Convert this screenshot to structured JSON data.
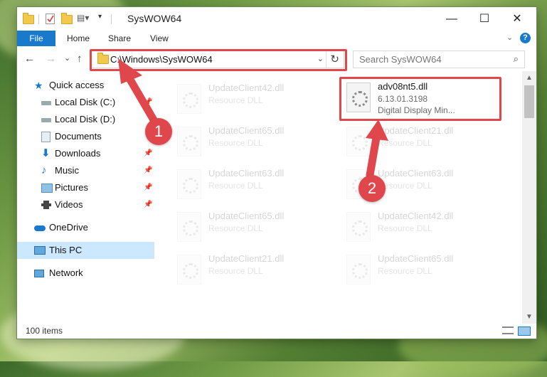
{
  "window": {
    "title": "SysWOW64",
    "minimize": "—",
    "maximize": "☐",
    "close": "✕"
  },
  "ribbon": {
    "tabs": [
      "File",
      "Home",
      "Share",
      "View"
    ],
    "collapse": "⌄",
    "help": "?"
  },
  "nav": {
    "back": "←",
    "forward": "→",
    "recent": "⌄",
    "up": "↑",
    "address": "C:\\Windows\\SysWOW64",
    "address_dropdown": "⌄",
    "refresh": "↻",
    "search_placeholder": "Search SysWOW64",
    "search_icon": "⌕"
  },
  "sidebar": {
    "items": [
      {
        "label": "Quick access",
        "icon": "star-icon"
      },
      {
        "label": "Local Disk (C:)",
        "icon": "drive-icon"
      },
      {
        "label": "Local Disk (D:)",
        "icon": "drive-icon"
      },
      {
        "label": "Documents",
        "icon": "documents-icon"
      },
      {
        "label": "Downloads",
        "icon": "downloads-icon"
      },
      {
        "label": "Music",
        "icon": "music-icon"
      },
      {
        "label": "Pictures",
        "icon": "pictures-icon"
      },
      {
        "label": "Videos",
        "icon": "videos-icon"
      },
      {
        "label": "OneDrive",
        "icon": "cloud-icon"
      },
      {
        "label": "This PC",
        "icon": "pc-icon"
      },
      {
        "label": "Network",
        "icon": "network-icon"
      }
    ],
    "pin": "📌"
  },
  "files": {
    "highlighted": {
      "name": "adv08nt5.dll",
      "version": "6.13.01.3198",
      "description": "Digital Display Min..."
    },
    "background": [
      {
        "name": "UpdateClient42.dll",
        "type": "Resource DLL"
      },
      {
        "name": "UpdateClient65.dll",
        "type": "Resource DLL"
      },
      {
        "name": "UpdateClient21.dll",
        "type": "Resource DLL"
      },
      {
        "name": "UpdateClient63.dll",
        "type": "Resource DLL"
      },
      {
        "name": "UpdateClient63.dll",
        "type": "Resource DLL"
      },
      {
        "name": "UpdateClient65.dll",
        "type": "Resource DLL"
      },
      {
        "name": "UpdateClient42.dll",
        "type": "Resource DLL"
      },
      {
        "name": "UpdateClient21.dll",
        "type": "Resource DLL"
      },
      {
        "name": "UpdateClient65.dll",
        "type": "Resource DLL"
      }
    ]
  },
  "status": {
    "items": "100 items"
  },
  "annotations": {
    "step1": "1",
    "step2": "2",
    "color": "#e0474c"
  }
}
